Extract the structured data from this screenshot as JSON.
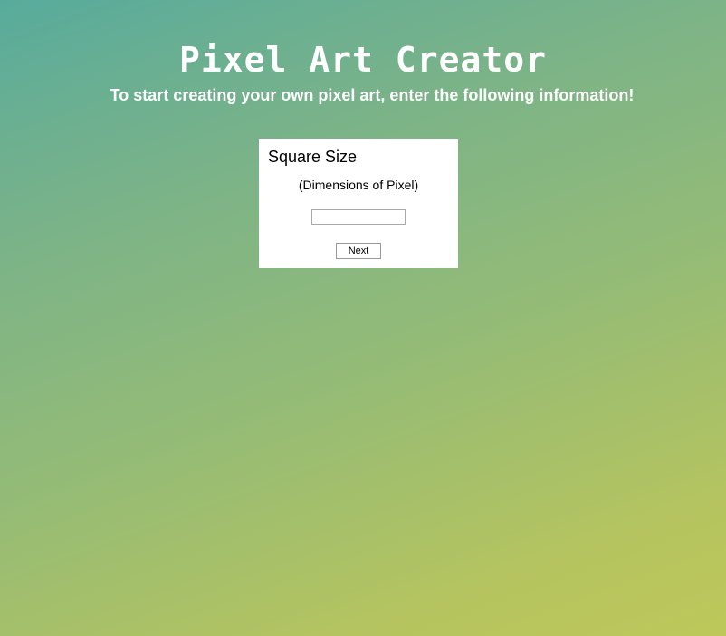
{
  "header": {
    "title": "Pixel Art Creator",
    "subtitle": "To start creating your own pixel art, enter the following information!"
  },
  "form": {
    "heading": "Square Size",
    "hint": "(Dimensions of Pixel)",
    "size_input": {
      "value": "",
      "placeholder": ""
    },
    "next_label": "Next"
  },
  "colors": {
    "gradient_start": "#58ab9c",
    "gradient_end": "#bec85a",
    "card_background": "#ffffff",
    "text_light": "#ffffff"
  }
}
